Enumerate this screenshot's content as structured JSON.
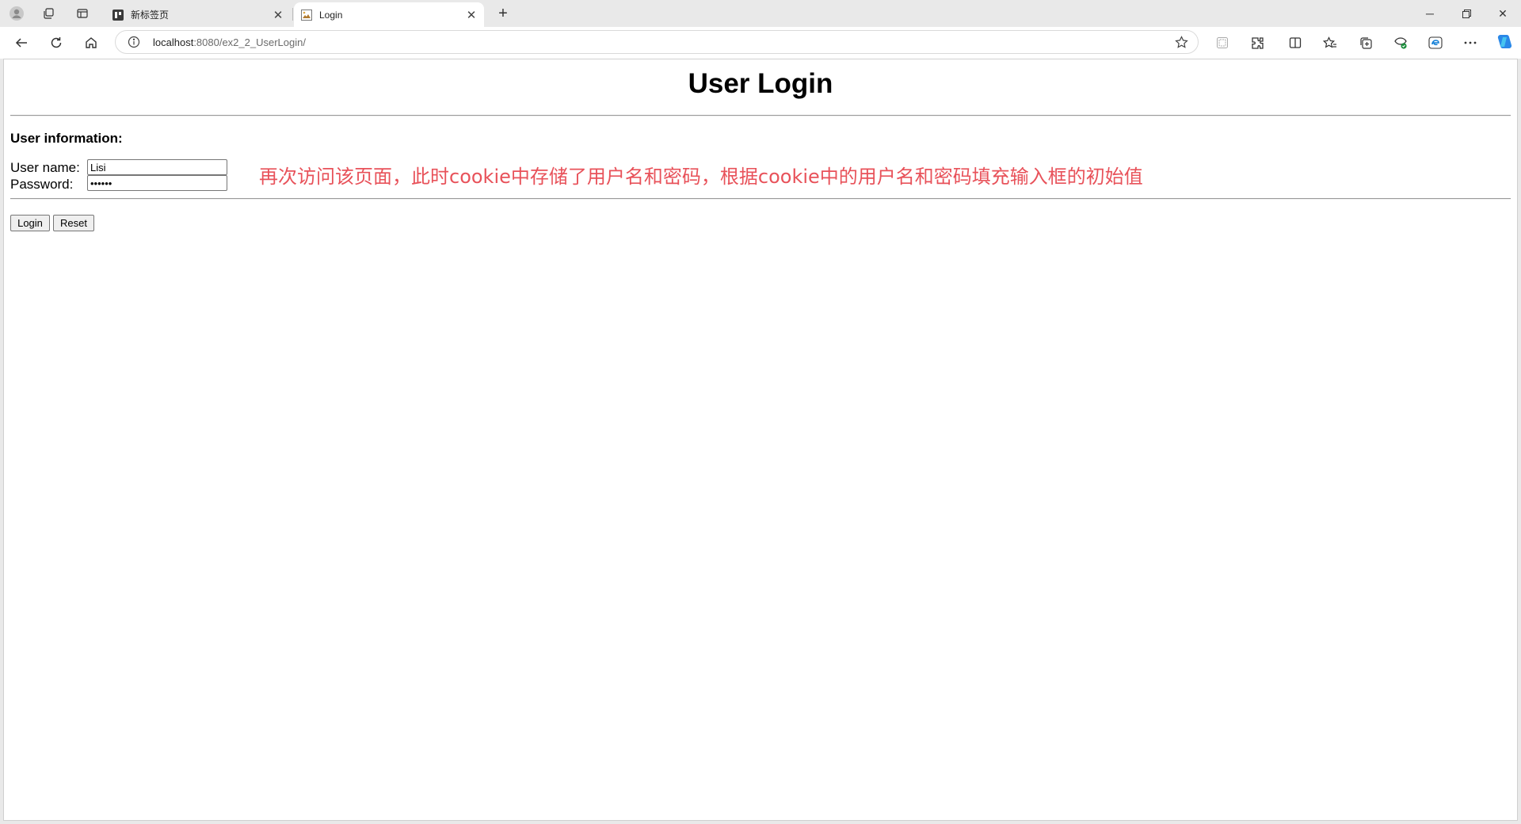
{
  "browser": {
    "tabs": [
      {
        "title": "新标签页",
        "active": false
      },
      {
        "title": "Login",
        "active": true
      }
    ],
    "address": {
      "host": "localhost",
      "path": ":8080/ex2_2_UserLogin/"
    },
    "icons": [
      "profile-icon",
      "workspaces-icon",
      "tab-actions-icon",
      "back-icon",
      "refresh-icon",
      "home-icon",
      "site-info-icon",
      "favorite-star-icon",
      "extensions-icon",
      "split-screen-icon",
      "favorites-icon",
      "collections-icon",
      "browser-essentials-icon",
      "edge-icon",
      "more-icon",
      "copilot-icon"
    ],
    "accent_color": "#1a73e8"
  },
  "page": {
    "heading": "User Login",
    "section_title": "User information:",
    "username_label": "User name:",
    "password_label": "Password:",
    "username_value": "Lisi",
    "password_value": "••••••",
    "note": "再次访问该页面，此时cookie中存储了用户名和密码，根据cookie中的用户名和密码填充输入框的初始值",
    "note_color": "#e8525a",
    "login_button": "Login",
    "reset_button": "Reset"
  }
}
